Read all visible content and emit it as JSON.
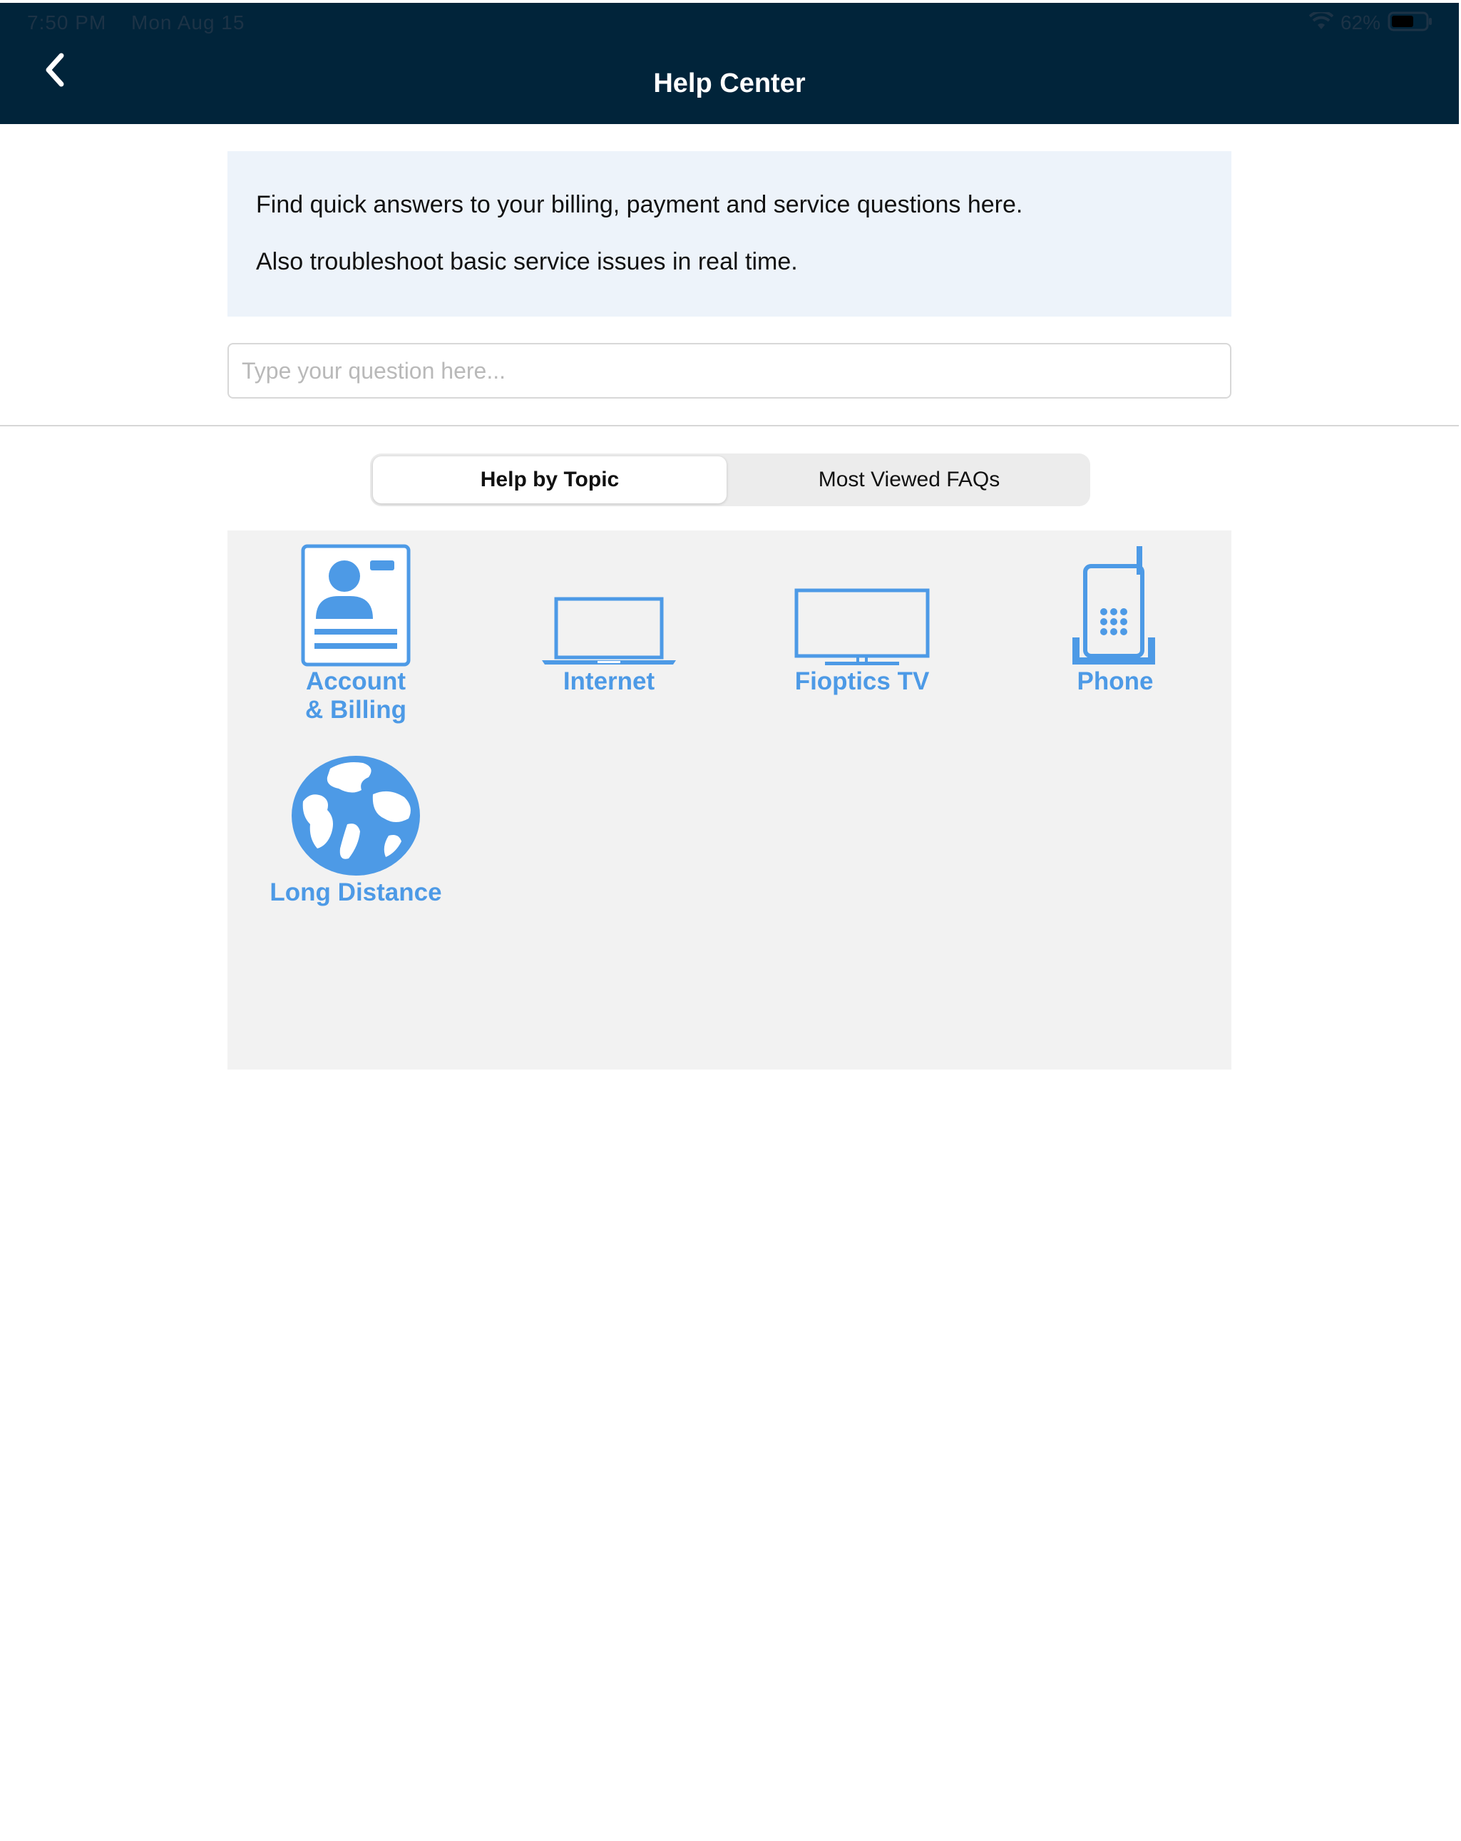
{
  "status_bar": {
    "time": "7:50 PM",
    "date": "Mon Aug 15",
    "battery": "62%"
  },
  "header": {
    "title": "Help Center"
  },
  "intro": {
    "line1": "Find quick answers to your billing, payment and service questions here.",
    "line2": "Also troubleshoot basic service issues in real time."
  },
  "search": {
    "placeholder": "Type your question here..."
  },
  "tabs": [
    {
      "label": "Help by Topic",
      "selected": true
    },
    {
      "label": "Most Viewed FAQs",
      "selected": false
    }
  ],
  "topics": [
    {
      "label": "Account\n& Billing",
      "icon": "account-card-icon"
    },
    {
      "label": "Internet",
      "icon": "laptop-icon"
    },
    {
      "label": "Fioptics TV",
      "icon": "tv-icon"
    },
    {
      "label": "Phone",
      "icon": "cordless-phone-icon"
    },
    {
      "label": "Long Distance",
      "icon": "globe-icon"
    }
  ],
  "colors": {
    "header_bg": "#01243a",
    "accent_blue": "#4d9ae6",
    "intro_bg": "#edf3fa",
    "topics_bg": "#f2f2f2"
  }
}
